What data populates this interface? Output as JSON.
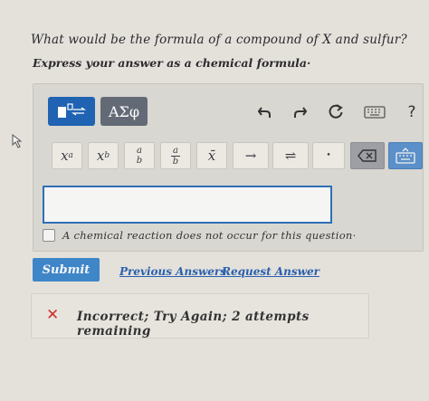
{
  "question": "What would be the formula of a compound of X and sulfur?",
  "instruction": "Express your answer as a chemical formula·",
  "toolbar": {
    "greek_label": "AΣφ",
    "help_label": "?"
  },
  "keys": {
    "superscript_base": "x",
    "superscript_exp": "a",
    "subscript_base": "x",
    "subscript_idx": "b",
    "frac_num": "a",
    "frac_den": "b",
    "frac2_num": "a",
    "frac2_den": "b",
    "xbar": "x̄",
    "arrow": "→",
    "equilibrium": "⇌",
    "dot": "•"
  },
  "answer": {
    "value": "",
    "placeholder": ""
  },
  "no_reaction_label": "A chemical reaction does not occur for this question·",
  "submit_label": "Submit",
  "previous_answers_label": "Previous Answers",
  "request_answer_label": "Request Answer",
  "feedback": {
    "message": "Incorrect; Try Again; 2 attempts remaining"
  },
  "colors": {
    "primary": "#1f63b2",
    "submit": "#3f86c8",
    "link": "#2a60ad",
    "error": "#d0322c"
  },
  "icons": [
    "template-icon",
    "undo-icon",
    "redo-icon",
    "reset-icon",
    "keyboard-icon",
    "help-icon",
    "backspace-icon",
    "keyboard-toggle-icon",
    "incorrect-icon",
    "cursor-arrow-icon"
  ]
}
